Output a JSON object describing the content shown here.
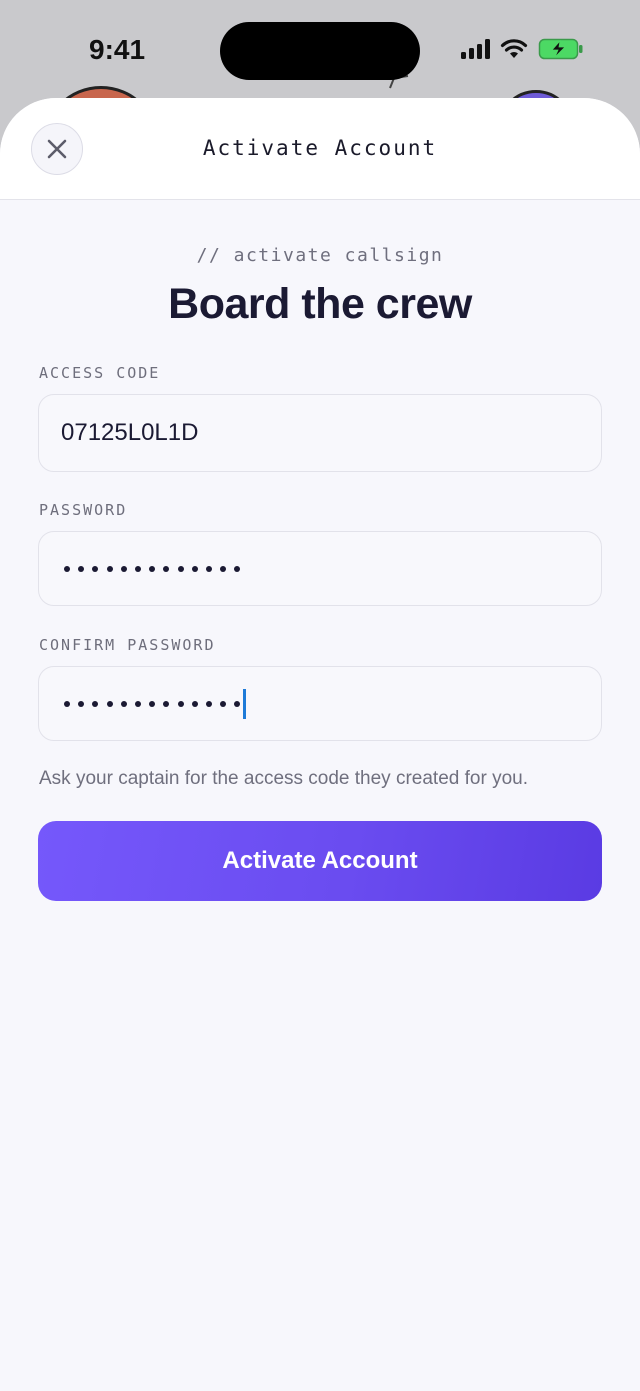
{
  "status_bar": {
    "time": "9:41",
    "icons": [
      "cellular-signal-icon",
      "wifi-icon",
      "battery-charging-icon"
    ],
    "battery_color": "#4cd964"
  },
  "sheet": {
    "title": "Activate Account",
    "close_icon": "close-icon"
  },
  "hero": {
    "eyebrow": "// activate callsign",
    "headline": "Board the crew"
  },
  "form": {
    "access_code": {
      "label": "ACCESS CODE",
      "value": "07125L0L1D"
    },
    "password": {
      "label": "PASSWORD",
      "masked_length": 13
    },
    "confirm_password": {
      "label": "CONFIRM PASSWORD",
      "masked_length": 13,
      "focused": true
    },
    "helper": "Ask your captain for the access code they created for you."
  },
  "actions": {
    "submit_label": "Activate Account"
  },
  "colors": {
    "accent_start": "#7558fb",
    "accent_end": "#5a3be3",
    "caret": "#1e7bd8",
    "text_primary": "#1b1a33",
    "text_muted": "#6f6f7e"
  }
}
